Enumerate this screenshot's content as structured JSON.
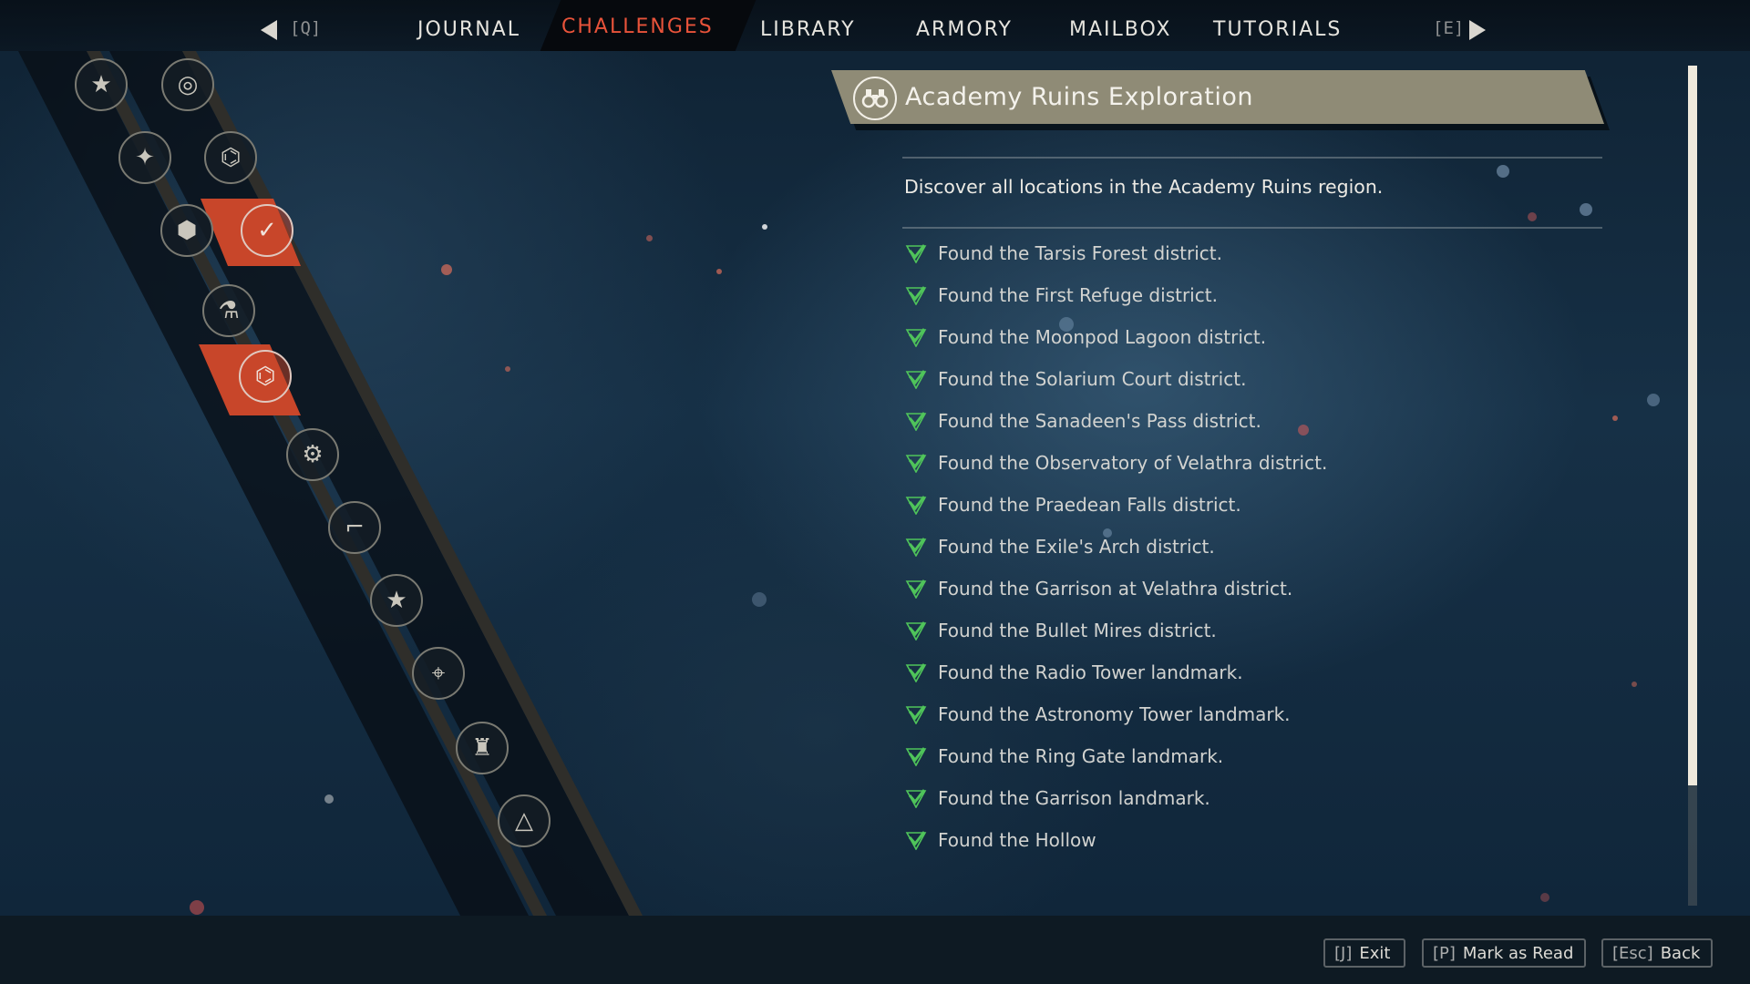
{
  "nav": {
    "prev_key": "[Q]",
    "next_key": "[E]",
    "tabs": [
      "JOURNAL",
      "CHALLENGES",
      "LIBRARY",
      "ARMORY",
      "MAILBOX",
      "TUTORIALS"
    ],
    "active_tab": "CHALLENGES"
  },
  "sidebar": {
    "icons": [
      {
        "name": "star-hexagon-icon",
        "glyph": "★",
        "selected": false
      },
      {
        "name": "triple-circle-icon",
        "glyph": "◎",
        "selected": false
      },
      {
        "name": "compass-star-icon",
        "glyph": "✦",
        "selected": false
      },
      {
        "name": "binoculars-icon",
        "glyph": "⌬",
        "selected": false
      },
      {
        "name": "hexagons-icon",
        "glyph": "⬢",
        "selected": false
      },
      {
        "name": "checkmark-icon",
        "glyph": "✓",
        "selected": true
      },
      {
        "name": "flask-icon",
        "glyph": "⚗",
        "selected": false
      },
      {
        "name": "binoculars-icon",
        "glyph": "⌬",
        "selected": true
      },
      {
        "name": "gear-icon",
        "glyph": "⚙",
        "selected": false
      },
      {
        "name": "gun-icon",
        "glyph": "⌐",
        "selected": false
      },
      {
        "name": "star-icon",
        "glyph": "★",
        "selected": false
      },
      {
        "name": "crosshair-icon",
        "glyph": "⌖",
        "selected": false
      },
      {
        "name": "soldier-icon",
        "glyph": "♜",
        "selected": false
      },
      {
        "name": "mountain-icon",
        "glyph": "△",
        "selected": false
      }
    ]
  },
  "challenge": {
    "title": "Academy Ruins Exploration",
    "icon": "binoculars-icon",
    "description": "Discover all locations in the Academy Ruins region.",
    "items": [
      "Found the Tarsis Forest district.",
      "Found the First Refuge district.",
      "Found the Moonpod Lagoon district.",
      "Found the Solarium Court district.",
      "Found the Sanadeen's Pass district.",
      "Found the Observatory of Velathra district.",
      "Found the Praedean Falls district.",
      "Found the Exile's Arch district.",
      "Found the Garrison at Velathra district.",
      "Found the Bullet Mires district.",
      "Found the Radio Tower landmark.",
      "Found the Astronomy Tower landmark.",
      "Found the Ring Gate landmark.",
      "Found the Garrison landmark.",
      "Found the Hollow"
    ],
    "check_color": "#4fc45a"
  },
  "footer": {
    "exit": {
      "key": "[J]",
      "label": "Exit"
    },
    "mark_read": {
      "key": "[P]",
      "label": "Mark as Read"
    },
    "back": {
      "key": "[Esc]",
      "label": "Back"
    }
  },
  "colors": {
    "accent": "#e8533a",
    "selected_tile": "#c8462a",
    "header_bg": "#8f8b76"
  }
}
